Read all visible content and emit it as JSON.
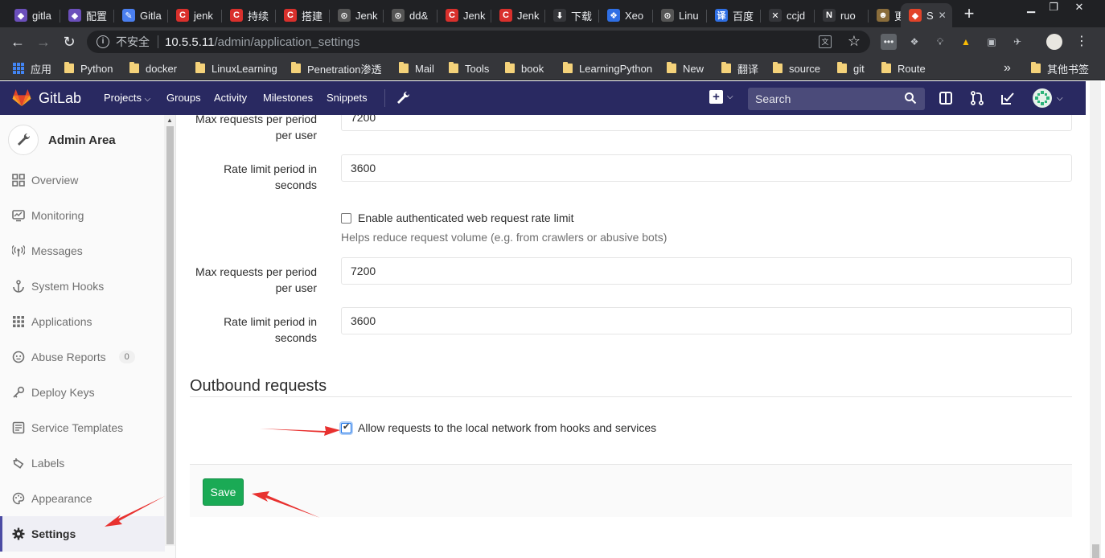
{
  "browser": {
    "tabs": [
      {
        "label": "gitla",
        "color": "#6b4fbb",
        "glyph": "◆"
      },
      {
        "label": "配置",
        "color": "#6b4fbb",
        "glyph": "◆"
      },
      {
        "label": "Gitla",
        "color": "#4a7ff0",
        "glyph": "✎"
      },
      {
        "label": "jenk",
        "color": "#d9302c",
        "glyph": "C"
      },
      {
        "label": "持续",
        "color": "#d9302c",
        "glyph": "C"
      },
      {
        "label": "搭建",
        "color": "#d9302c",
        "glyph": "C"
      },
      {
        "label": "Jenk",
        "color": "#555555",
        "glyph": "⊙"
      },
      {
        "label": "dd&",
        "color": "#555555",
        "glyph": "⊙"
      },
      {
        "label": "Jenk",
        "color": "#d9302c",
        "glyph": "C"
      },
      {
        "label": "Jenk",
        "color": "#d9302c",
        "glyph": "C"
      },
      {
        "label": "下载",
        "color": "#35363a",
        "glyph": "⬇"
      },
      {
        "label": "Xeo",
        "color": "#2f6fe4",
        "glyph": "❖"
      },
      {
        "label": "Linu",
        "color": "#555555",
        "glyph": "⊙"
      },
      {
        "label": "百度",
        "color": "#2f6fe4",
        "glyph": "译"
      },
      {
        "label": "ccjd",
        "color": "#35363a",
        "glyph": "✕"
      },
      {
        "label": "ruo",
        "color": "#35363a",
        "glyph": "N"
      },
      {
        "label": "更新",
        "color": "#8a6d3b",
        "glyph": "☻"
      },
      {
        "label": "S",
        "color": "#e24329",
        "glyph": "◆"
      }
    ],
    "security_label": "不安全",
    "url_host": "10.5.5.11",
    "url_path": "/admin/application_settings",
    "bookmarks": [
      {
        "label": "应用",
        "type": "apps"
      },
      {
        "label": "Python",
        "type": "folder"
      },
      {
        "label": "docker",
        "type": "folder"
      },
      {
        "label": "LinuxLearning",
        "type": "folder"
      },
      {
        "label": "Penetration渗透",
        "type": "folder"
      },
      {
        "label": "Mail",
        "type": "folder"
      },
      {
        "label": "Tools",
        "type": "folder"
      },
      {
        "label": "book",
        "type": "folder"
      },
      {
        "label": "LearningPython",
        "type": "folder"
      },
      {
        "label": "New",
        "type": "folder"
      },
      {
        "label": "翻译",
        "type": "folder"
      },
      {
        "label": "source",
        "type": "folder"
      },
      {
        "label": "git",
        "type": "folder"
      },
      {
        "label": "Route",
        "type": "folder"
      }
    ],
    "bookmarks_overflow": "»",
    "other_bookmarks": "其他书签"
  },
  "gitlab_nav": {
    "brand": "GitLab",
    "items": [
      "Projects",
      "Groups",
      "Activity",
      "Milestones",
      "Snippets"
    ],
    "search_placeholder": "Search",
    "brand_color": "#292961"
  },
  "sidebar": {
    "title": "Admin Area",
    "items": [
      {
        "label": "Overview",
        "icon": "grid-icon"
      },
      {
        "label": "Monitoring",
        "icon": "monitor-icon"
      },
      {
        "label": "Messages",
        "icon": "broadcast-icon"
      },
      {
        "label": "System Hooks",
        "icon": "anchor-icon"
      },
      {
        "label": "Applications",
        "icon": "apps-icon"
      },
      {
        "label": "Abuse Reports",
        "icon": "abuse-icon",
        "badge": "0"
      },
      {
        "label": "Deploy Keys",
        "icon": "key-icon"
      },
      {
        "label": "Service Templates",
        "icon": "template-icon"
      },
      {
        "label": "Labels",
        "icon": "label-icon"
      },
      {
        "label": "Appearance",
        "icon": "palette-icon"
      },
      {
        "label": "Settings",
        "icon": "gear-icon",
        "active": true
      }
    ]
  },
  "main": {
    "unauth_max_requests_label": "Max requests per period per user",
    "unauth_max_requests_value": "7200",
    "unauth_period_label": "Rate limit period in seconds",
    "unauth_period_value": "3600",
    "auth_web_checkbox_label": "Enable authenticated web request rate limit",
    "auth_web_checked": false,
    "auth_web_help": "Helps reduce request volume (e.g. from crawlers or abusive bots)",
    "auth_max_requests_label": "Max requests per period per user",
    "auth_max_requests_value": "7200",
    "auth_period_label": "Rate limit period in seconds",
    "auth_period_value": "3600",
    "outbound_title": "Outbound requests",
    "local_network_label": "Allow requests to the local network from hooks and services",
    "local_network_checked": true,
    "save_label": "Save",
    "save_color": "#1aaa55",
    "annotation_color": "#e8312f"
  }
}
